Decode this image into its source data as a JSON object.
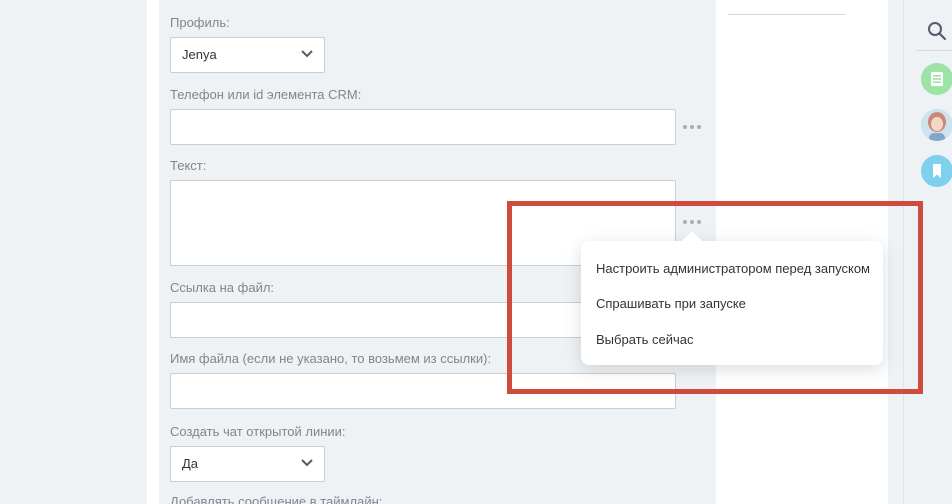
{
  "form": {
    "profile": {
      "label": "Профиль:",
      "value": "Jenya"
    },
    "phone": {
      "label": "Телефон или id элемента CRM:",
      "value": ""
    },
    "text": {
      "label": "Текст:",
      "value": ""
    },
    "file_link": {
      "label": "Ссылка на файл:",
      "value": ""
    },
    "file_name": {
      "label": "Имя файла (если не указано, то возьмем из ссылки):",
      "value": ""
    },
    "open_line_chat": {
      "label": "Создать чат открытой линии:",
      "value": "Да"
    },
    "timeline": {
      "label": "Добавлять сообщение в таймлайн:"
    }
  },
  "popup_menu": {
    "items": [
      {
        "label": "Настроить администратором перед запуском"
      },
      {
        "label": "Спрашивать при запуске"
      },
      {
        "label": "Выбрать сейчас"
      }
    ]
  },
  "sidebar": {
    "icons": [
      "search-icon",
      "sheet-app-icon",
      "user-avatar",
      "bookmark-icon"
    ]
  },
  "colors": {
    "background": "#eef2f4",
    "highlight_border": "#cf4b3b",
    "sheet_icon_bg": "#9de3a6",
    "bookmark_icon_bg": "#7ed0ee"
  }
}
